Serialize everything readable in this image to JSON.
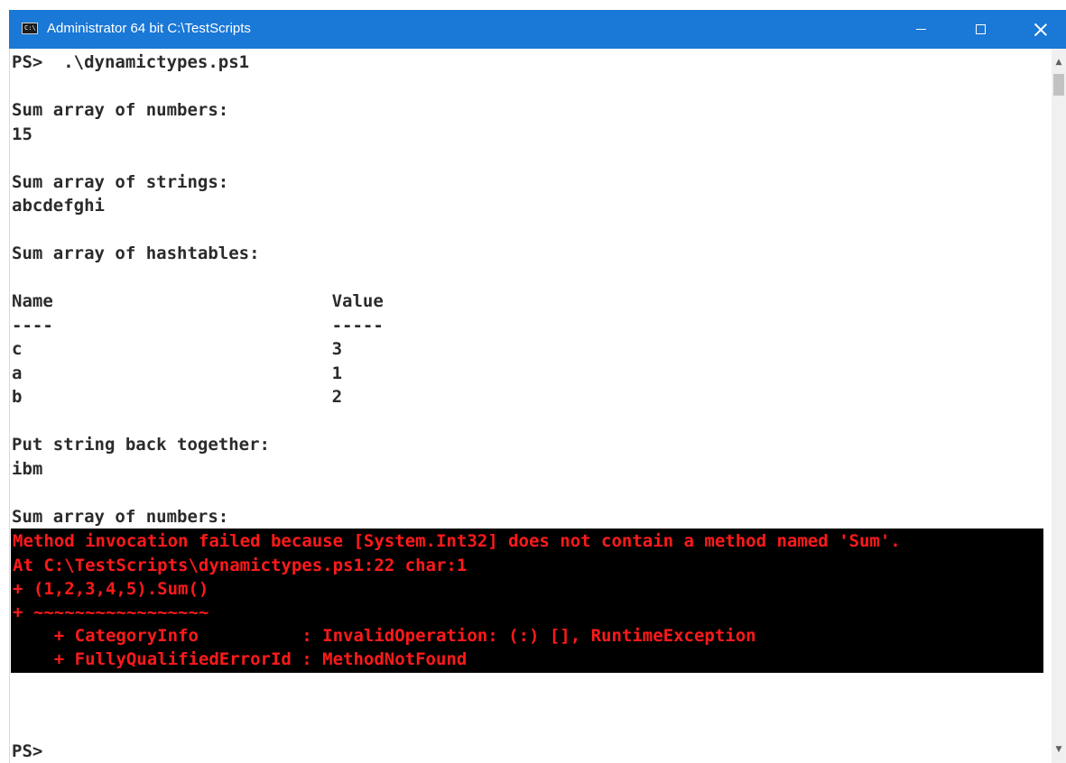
{
  "window": {
    "title": "Administrator 64 bit C:\\TestScripts",
    "icon": "console-icon",
    "controls": {
      "minimize": "minimize-icon",
      "maximize": "maximize-icon",
      "close": "close-icon"
    }
  },
  "console": {
    "lines": [
      "PS>  .\\dynamictypes.ps1",
      "",
      "Sum array of numbers:",
      "15",
      "",
      "Sum array of strings:",
      "abcdefghi",
      "",
      "Sum array of hashtables:",
      "",
      "Name                           Value",
      "----                           -----",
      "c                              3",
      "a                              1",
      "b                              2",
      "",
      "Put string back together:",
      "ibm",
      "",
      "Sum array of numbers:"
    ],
    "error_lines": [
      "Method invocation failed because [System.Int32] does not contain a method named 'Sum'.",
      "At C:\\TestScripts\\dynamictypes.ps1:22 char:1",
      "+ (1,2,3,4,5).Sum()",
      "+ ~~~~~~~~~~~~~~~~~",
      "    + CategoryInfo          : InvalidOperation: (:) [], RuntimeException",
      "    + FullyQualifiedErrorId : MethodNotFound"
    ],
    "final_prompt": "PS>"
  },
  "colors": {
    "titlebar": "#1a78d6",
    "console_bg": "#ffffff",
    "console_text": "#2b2b2b",
    "error_bg": "#000000",
    "error_text": "#ff1a1a"
  }
}
